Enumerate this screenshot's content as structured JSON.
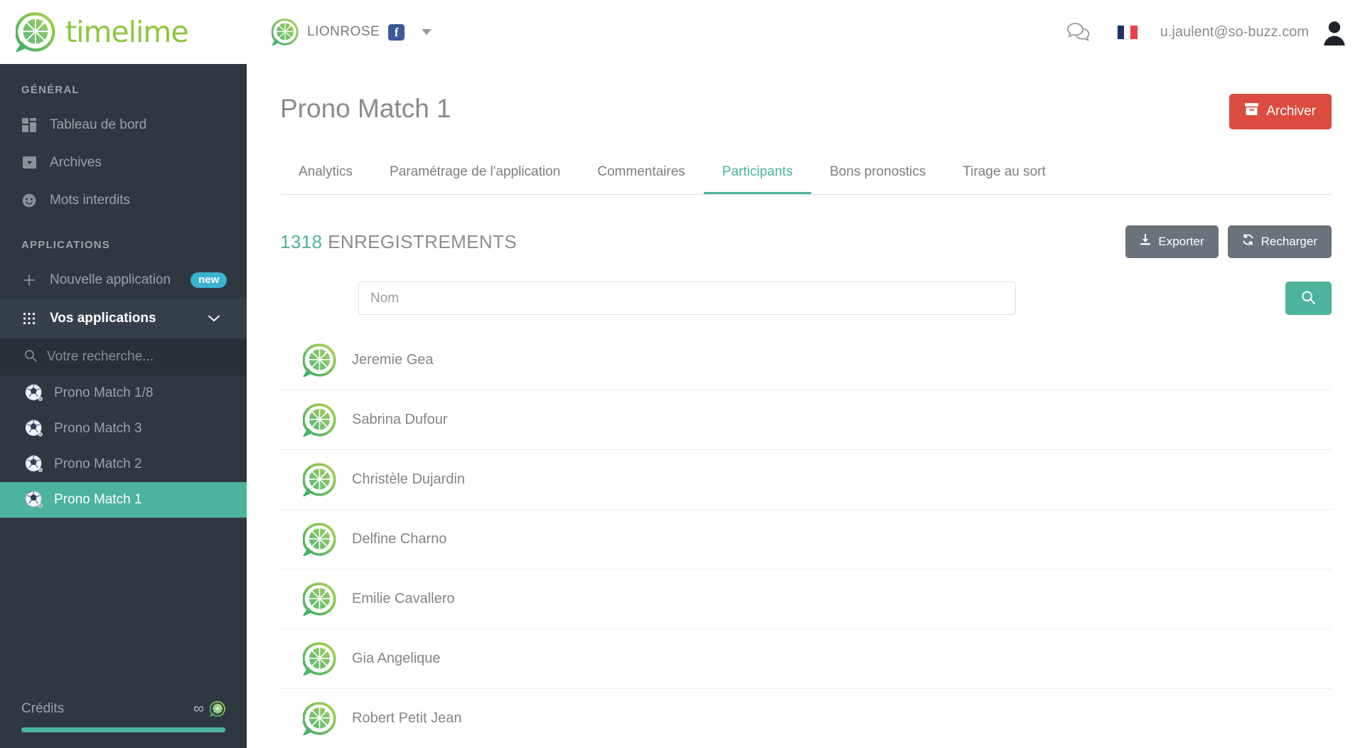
{
  "brand": {
    "name": "timelime",
    "logo_icon": "lime-logo-icon"
  },
  "topbar": {
    "page_selector": {
      "logo_icon": "lime-logo-icon",
      "name": "LIONROSE",
      "network_icon": "facebook-icon",
      "network_letter": "f",
      "caret_icon": "caret-down-icon"
    },
    "chat_icon": "comments-icon",
    "language_flag": "french-flag-icon",
    "user_email": "u.jaulent@so-buzz.com",
    "avatar_icon": "user-avatar-icon"
  },
  "sidebar": {
    "general_title": "GÉNÉRAL",
    "general_items": [
      {
        "label": "Tableau de bord",
        "icon": "dashboard-icon"
      },
      {
        "label": "Archives",
        "icon": "archive-icon"
      },
      {
        "label": "Mots interdits",
        "icon": "smiley-icon"
      }
    ],
    "applications_title": "APPLICATIONS",
    "new_app": {
      "label": "Nouvelle application",
      "badge": "new",
      "icon": "plus-icon"
    },
    "your_apps": {
      "label": "Vos applications",
      "icon": "grid-icon",
      "chevron": "chevron-down-icon"
    },
    "search_placeholder": "Votre recherche...",
    "search_value": "",
    "search_icon": "search-icon",
    "apps": [
      {
        "label": "Prono Match 1/8",
        "icon": "soccer-ball-icon",
        "active": false
      },
      {
        "label": "Prono Match 3",
        "icon": "soccer-ball-icon",
        "active": false
      },
      {
        "label": "Prono Match 2",
        "icon": "soccer-ball-icon",
        "active": false
      },
      {
        "label": "Prono Match 1",
        "icon": "soccer-ball-icon",
        "active": true
      }
    ],
    "credits": {
      "label": "Crédits",
      "value": "∞",
      "icon": "lime-logo-icon",
      "progress_percent": 100
    }
  },
  "main": {
    "page_title": "Prono Match 1",
    "archive_button": {
      "label": "Archiver",
      "icon": "archive-box-icon"
    },
    "tabs": [
      {
        "label": "Analytics",
        "active": false
      },
      {
        "label": "Paramétrage de l'application",
        "active": false
      },
      {
        "label": "Commentaires",
        "active": false
      },
      {
        "label": "Participants",
        "active": true
      },
      {
        "label": "Bons pronostics",
        "active": false
      },
      {
        "label": "Tirage au sort",
        "active": false
      }
    ],
    "records": {
      "count": "1318",
      "label": "ENREGISTREMENTS"
    },
    "export_button": {
      "label": "Exporter",
      "icon": "download-icon"
    },
    "reload_button": {
      "label": "Recharger",
      "icon": "refresh-icon"
    },
    "name_filter": {
      "placeholder": "Nom",
      "value": ""
    },
    "search_button": {
      "icon": "search-icon"
    },
    "participants": [
      {
        "name": "Jeremie Gea",
        "avatar_icon": "lime-logo-icon"
      },
      {
        "name": "Sabrina Dufour",
        "avatar_icon": "lime-logo-icon"
      },
      {
        "name": "Christèle Dujardin",
        "avatar_icon": "lime-logo-icon"
      },
      {
        "name": "Delfine Charno",
        "avatar_icon": "lime-logo-icon"
      },
      {
        "name": "Emilie Cavallero",
        "avatar_icon": "lime-logo-icon"
      },
      {
        "name": "Gia Angelique",
        "avatar_icon": "lime-logo-icon"
      },
      {
        "name": "Robert Petit Jean",
        "avatar_icon": "lime-logo-icon"
      }
    ]
  },
  "colors": {
    "accent_teal": "#4cb39c",
    "brand_green": "#8dc63f",
    "danger_red": "#dc4b3f",
    "sidebar_dark": "#2f3841",
    "badge_blue": "#3ab3d0"
  }
}
